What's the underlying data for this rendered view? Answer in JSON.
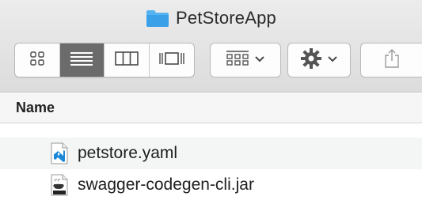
{
  "window": {
    "title": "PetStoreApp"
  },
  "toolbar": {
    "view_buttons": [
      {
        "name": "icon-view",
        "icon": "grid-icon",
        "active": false
      },
      {
        "name": "list-view",
        "icon": "list-icon",
        "active": true
      },
      {
        "name": "column-view",
        "icon": "columns-icon",
        "active": false
      },
      {
        "name": "gallery-view",
        "icon": "gallery-icon",
        "active": false
      }
    ],
    "arrange_icon": "arrange-grid-icon",
    "action_icon": "gear-icon",
    "share_icon": "share-icon"
  },
  "list": {
    "header": "Name",
    "files": [
      {
        "name": "petstore.yaml",
        "icon": "yaml-file-icon"
      },
      {
        "name": "swagger-codegen-cli.jar",
        "icon": "jar-file-icon"
      }
    ]
  },
  "colors": {
    "folder": "#3aa0e8",
    "active_view": "#6b6b6b",
    "vscode_blue": "#1e88d8"
  }
}
